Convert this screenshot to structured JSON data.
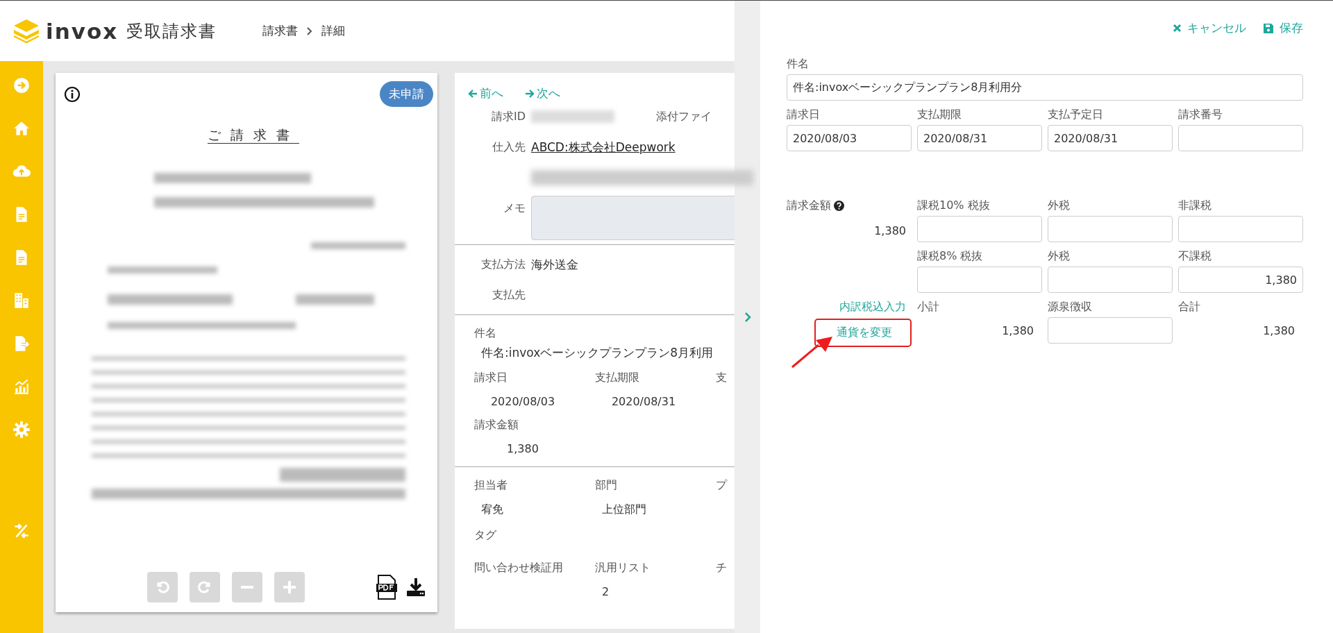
{
  "header": {
    "logo_text": "invox",
    "product": "受取請求書",
    "breadcrumb": [
      "請求書",
      "詳細"
    ]
  },
  "viewer": {
    "status_badge": "未申請",
    "doc_title": "ご請求書",
    "toolbar": [
      {
        "kind": "rotate-left",
        "disabled": true
      },
      {
        "kind": "rotate-right",
        "disabled": true
      },
      {
        "kind": "zoom-out",
        "disabled": true
      },
      {
        "kind": "zoom-in",
        "disabled": true
      }
    ]
  },
  "details": {
    "nav": [
      {
        "kind": "prev",
        "label": "前へ"
      },
      {
        "kind": "next",
        "label": "次へ"
      }
    ],
    "top_rows": [
      {
        "kind": "redacted",
        "label": "請求ID",
        "side_label": "添付ファイ"
      },
      {
        "kind": "link",
        "label": "仕入先",
        "value": "ABCD:株式会社Deepwork"
      },
      {
        "kind": "address"
      },
      {
        "kind": "memo",
        "label": "メモ"
      }
    ],
    "payment_rows": [
      {
        "label": "支払方法",
        "value": "海外送金"
      },
      {
        "label": "支払先"
      }
    ],
    "subject": {
      "label": "件名",
      "value": "件名:invoxベーシックプランプラン8月利用"
    },
    "dates": [
      {
        "label": "請求日",
        "value": "2020/08/03"
      },
      {
        "label": "支払期限",
        "value": "2020/08/31"
      },
      {
        "label": "支"
      }
    ],
    "amount": {
      "label": "請求金額",
      "value": "1,380"
    },
    "people": [
      {
        "label": "担当者",
        "value": "宥免"
      },
      {
        "label": "部門",
        "value": "上位部門"
      },
      {
        "label": "プ"
      }
    ],
    "tag_label": "タグ",
    "custom": [
      {
        "label": "問い合わせ検証用"
      },
      {
        "label": "汎用リスト",
        "value": "2"
      },
      {
        "label": "チ"
      }
    ]
  },
  "edit_panel": {
    "actions": [
      {
        "kind": "cancel",
        "label": "キャンセル"
      },
      {
        "kind": "save",
        "label": "保存"
      }
    ],
    "subject": {
      "label": "件名",
      "value": "件名:invoxベーシックプランプラン8月利用分"
    },
    "date_fields": [
      {
        "label": "請求日",
        "value": "2020/08/03"
      },
      {
        "label": "支払期限",
        "value": "2020/08/31"
      },
      {
        "label": "支払予定日",
        "value": "2020/08/31"
      },
      {
        "label": "請求番号"
      }
    ],
    "amount_grid": [
      {
        "kind": "summary",
        "label": "請求金額",
        "value": "1,380"
      },
      {
        "kind": "field",
        "label": "課税10% 税抜"
      },
      {
        "kind": "field",
        "label": "外税"
      },
      {
        "kind": "field",
        "label": "非課税"
      },
      {
        "kind": "blank"
      },
      {
        "kind": "field",
        "label": "課税8% 税抜"
      },
      {
        "kind": "field",
        "label": "外税"
      },
      {
        "kind": "field",
        "label": "不課税",
        "value": "1,380"
      },
      {
        "kind": "links",
        "label": "内訳税込入力",
        "action": "通貨を変更"
      },
      {
        "kind": "text",
        "label": "小計",
        "value": "1,380"
      },
      {
        "kind": "field",
        "label": "源泉徴収"
      },
      {
        "kind": "text",
        "label": "合計",
        "value": "1,380"
      }
    ]
  }
}
